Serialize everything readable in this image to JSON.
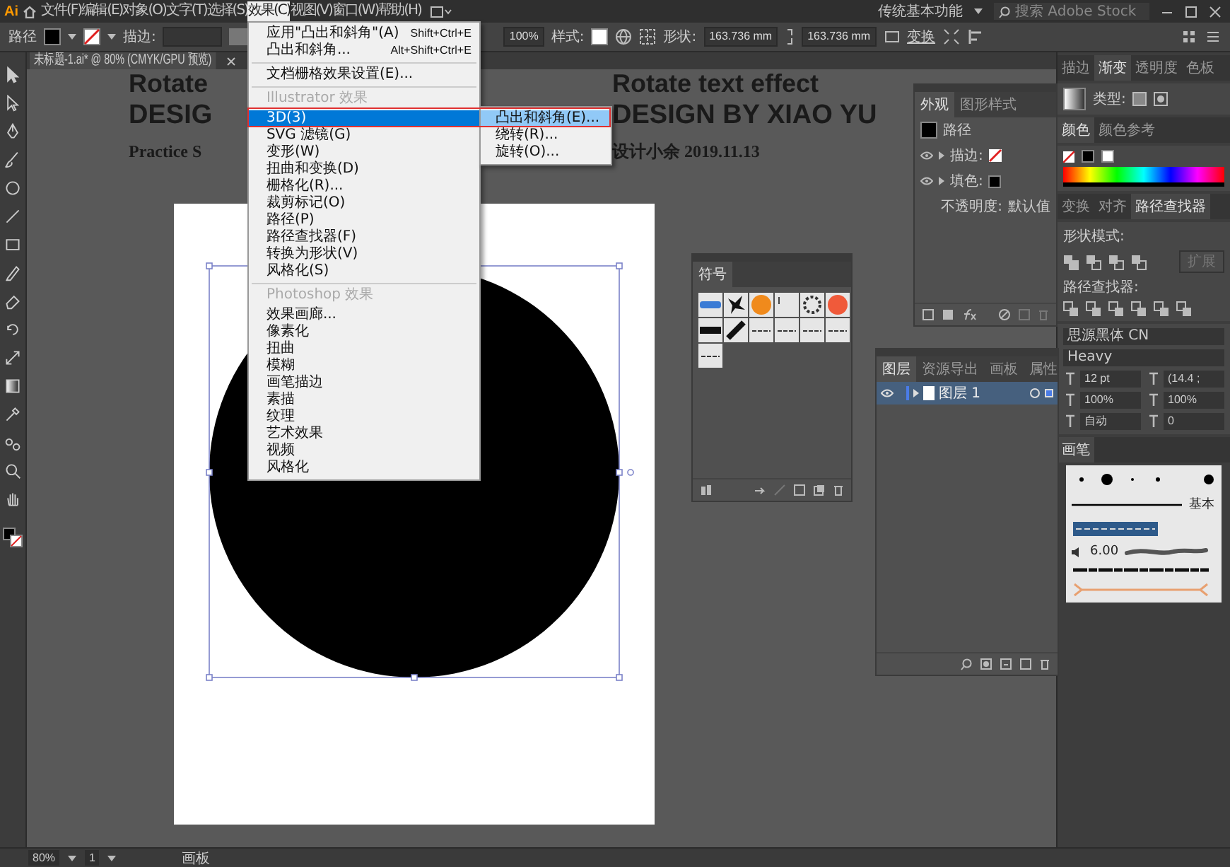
{
  "app_logo": "Ai",
  "menubar": {
    "items": [
      {
        "label": "文件(F)",
        "selected": false
      },
      {
        "label": "编辑(E)",
        "selected": false
      },
      {
        "label": "对象(O)",
        "selected": false
      },
      {
        "label": "文字(T)",
        "selected": false
      },
      {
        "label": "选择(S)",
        "selected": false
      },
      {
        "label": "效果(C)",
        "selected": true
      },
      {
        "label": "视图(V)",
        "selected": false
      },
      {
        "label": "窗口(W)",
        "selected": false
      },
      {
        "label": "帮助(H)",
        "selected": false
      }
    ]
  },
  "workspace_switcher": "传统基本功能",
  "stock_search": {
    "placeholder": "搜索 Adobe Stock"
  },
  "control_bar": {
    "object_type": "路径",
    "stroke_label": "描边:",
    "opacity": "100%",
    "style_label": "样式:",
    "shape_label": "形状:",
    "width": "163.736 mm",
    "height": "163.736 mm",
    "transform": "变换"
  },
  "document_tab": {
    "title": "未标题-1.ai* @ 80% (CMYK/GPU 预览)"
  },
  "effect_menu": {
    "items": [
      {
        "kind": "item",
        "label": "应用\"凸出和斜角\"(A)",
        "shortcut": "Shift+Ctrl+E",
        "selected": false
      },
      {
        "kind": "item",
        "label": "凸出和斜角...",
        "shortcut": "Alt+Shift+Ctrl+E",
        "selected": false
      },
      {
        "kind": "separator"
      },
      {
        "kind": "item",
        "label": "文档栅格效果设置(E)...",
        "selected": false
      },
      {
        "kind": "separator"
      },
      {
        "kind": "header",
        "label": "Illustrator 效果"
      },
      {
        "kind": "item",
        "label": "3D(3)",
        "selected": true,
        "submenu": [
          {
            "label": "凸出和斜角(E)...",
            "selected": true
          },
          {
            "label": "绕转(R)...",
            "selected": false
          },
          {
            "label": "旋转(O)...",
            "selected": false
          }
        ]
      },
      {
        "kind": "item",
        "label": "SVG 滤镜(G)",
        "selected": false
      },
      {
        "kind": "item",
        "label": "变形(W)",
        "selected": false
      },
      {
        "kind": "item",
        "label": "扭曲和变换(D)",
        "selected": false
      },
      {
        "kind": "item",
        "label": "栅格化(R)...",
        "selected": false
      },
      {
        "kind": "item",
        "label": "裁剪标记(O)",
        "selected": false
      },
      {
        "kind": "item",
        "label": "路径(P)",
        "selected": false
      },
      {
        "kind": "item",
        "label": "路径查找器(F)",
        "selected": false
      },
      {
        "kind": "item",
        "label": "转换为形状(V)",
        "selected": false
      },
      {
        "kind": "item",
        "label": "风格化(S)",
        "selected": false
      },
      {
        "kind": "separator"
      },
      {
        "kind": "header",
        "label": "Photoshop 效果"
      },
      {
        "kind": "item",
        "label": "效果画廊...",
        "selected": false
      },
      {
        "kind": "item",
        "label": "像素化",
        "selected": false
      },
      {
        "kind": "item",
        "label": "扭曲",
        "selected": false
      },
      {
        "kind": "item",
        "label": "模糊",
        "selected": false
      },
      {
        "kind": "item",
        "label": "画笔描边",
        "selected": false
      },
      {
        "kind": "item",
        "label": "素描",
        "selected": false
      },
      {
        "kind": "item",
        "label": "纹理",
        "selected": false
      },
      {
        "kind": "item",
        "label": "艺术效果",
        "selected": false
      },
      {
        "kind": "item",
        "label": "视频",
        "selected": false
      },
      {
        "kind": "item",
        "label": "风格化",
        "selected": false
      }
    ]
  },
  "artwork": {
    "left_lines": [
      "Rotate",
      "DESIG",
      "Practice S"
    ],
    "right_lines": [
      "Rotate text effect",
      "DESIGN BY XIAO YU",
      "设计小余  2019.11.13"
    ]
  },
  "appearance_panel": {
    "tabs": [
      {
        "label": "外观",
        "selected": true
      },
      {
        "label": "图形样式",
        "selected": false
      }
    ],
    "title": "路径",
    "rows": [
      {
        "kind": "stroke",
        "label": "描边:"
      },
      {
        "kind": "fill",
        "label": "填色:"
      },
      {
        "kind": "opacity",
        "label": "不透明度:",
        "value": "默认值"
      }
    ]
  },
  "symbols_panel": {
    "tabs": [
      {
        "label": "符号",
        "selected": true
      }
    ]
  },
  "layers_panel": {
    "tabs": [
      {
        "label": "图层",
        "selected": true
      },
      {
        "label": "资源导出",
        "selected": false
      },
      {
        "label": "画板",
        "selected": false
      },
      {
        "label": "属性",
        "selected": false
      }
    ],
    "layers": [
      {
        "name": "图层 1",
        "selected": true
      }
    ]
  },
  "right_dock": {
    "gradient_tabs": [
      {
        "label": "描边",
        "selected": false
      },
      {
        "label": "渐变",
        "selected": true
      },
      {
        "label": "透明度",
        "selected": false
      },
      {
        "label": "色板",
        "selected": false
      }
    ],
    "gradient_type_label": "类型:",
    "color_tabs": [
      {
        "label": "颜色",
        "selected": true
      },
      {
        "label": "颜色参考",
        "selected": false
      }
    ],
    "pathfinder_tabs": [
      {
        "label": "变换",
        "selected": false
      },
      {
        "label": "对齐",
        "selected": false
      },
      {
        "label": "路径查找器",
        "selected": true
      }
    ],
    "shape_modes_label": "形状模式:",
    "expand_button": {
      "label": "扩展",
      "disabled": true
    },
    "pathfinders_label": "路径查找器:",
    "font_family": "思源黑体 CN",
    "font_style": "Heavy",
    "char_fields": [
      "12 pt",
      "(14.4 ;",
      "100%",
      "100%",
      "自动",
      "0"
    ],
    "brushes_tabs": [
      {
        "label": "画笔",
        "selected": true
      }
    ],
    "brush_basic_label": "基本",
    "brush_size_label": "6.00"
  },
  "status_bar": {
    "zoom": "80%",
    "artboard_number": "1",
    "tool_name": "画板"
  }
}
